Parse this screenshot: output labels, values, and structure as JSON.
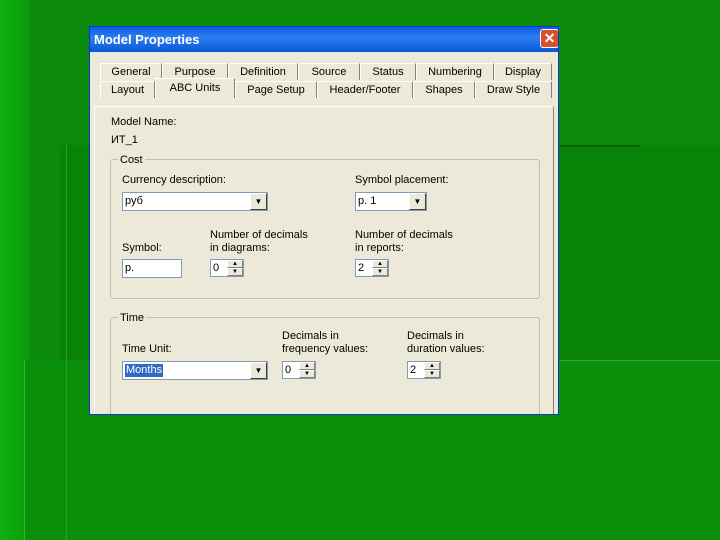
{
  "window": {
    "title": "Model Properties",
    "close_symbol": "✕"
  },
  "tabs": {
    "row1": [
      "General",
      "Purpose",
      "Definition",
      "Source",
      "Status",
      "Numbering",
      "Display"
    ],
    "row2": [
      "Layout",
      "ABC Units",
      "Page Setup",
      "Header/Footer",
      "Shapes",
      "Draw Style"
    ],
    "active": "ABC Units"
  },
  "model": {
    "name_label": "Model Name:",
    "name_value": "ИТ_1"
  },
  "cost": {
    "legend": "Cost",
    "currency_label": "Currency description:",
    "currency_value": "руб",
    "symbol_placement_label": "Symbol placement:",
    "symbol_placement_value": "р. 1",
    "symbol_label": "Symbol:",
    "symbol_value": "р.",
    "decimals_diagrams_label_1": "Number of decimals",
    "decimals_diagrams_label_2": "in diagrams:",
    "decimals_diagrams_value": "0",
    "decimals_reports_label_1": "Number of decimals",
    "decimals_reports_label_2": "in reports:",
    "decimals_reports_value": "2"
  },
  "time": {
    "legend": "Time",
    "unit_label": "Time Unit:",
    "unit_value": "Months",
    "freq_label_1": "Decimals in",
    "freq_label_2": "frequency values:",
    "freq_value": "0",
    "duration_label_1": "Decimals in",
    "duration_label_2": "duration values:",
    "duration_value": "2"
  },
  "icons": {
    "dropdown": "▼",
    "spin_up": "▲",
    "spin_down": "▼"
  }
}
